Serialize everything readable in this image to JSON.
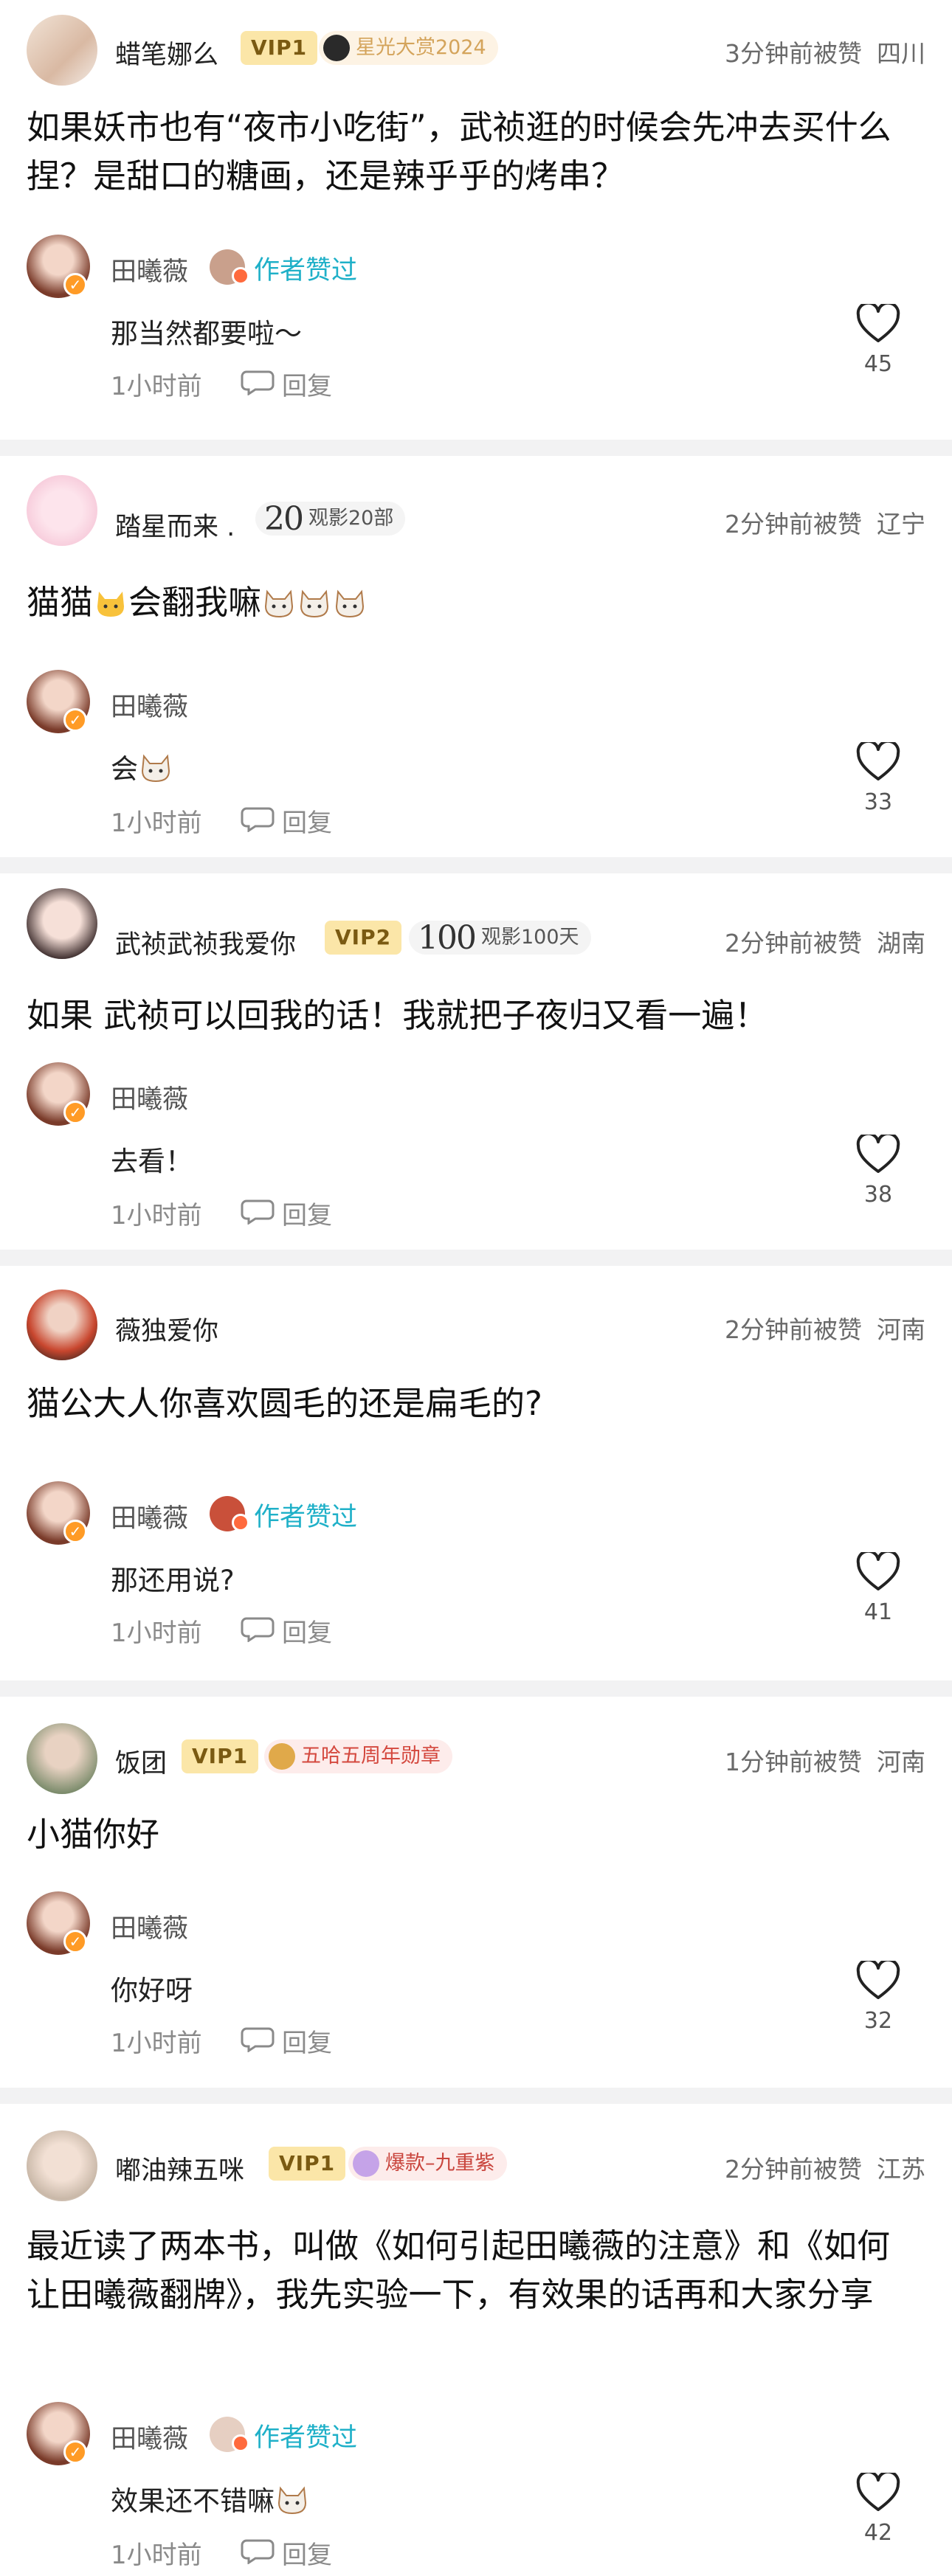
{
  "comments": [
    {
      "user": "蜡笔娜么",
      "vip": "VIP1",
      "badge": "星光大赏2024",
      "time": "3分钟前被赞",
      "region": "四川",
      "text": "如果妖市也有“夜市小吃街”，武祯逛的时候会先冲去买什么捏？是甜口的糖画，还是辣乎乎的烤串？",
      "reply": {
        "user": "田曦薇",
        "liked_label": "作者赞过",
        "text": "那当然都要啦～",
        "time": "1小时前",
        "reply_label": "回复",
        "likes": "45"
      }
    },
    {
      "user": "踏星而来 .",
      "badge_num": "20",
      "badge": "观影20部",
      "time": "2分钟前被赞",
      "region": "辽宁",
      "text": "猫猫",
      "text2": "会翻我嘛",
      "reply": {
        "user": "田曦薇",
        "text": "会",
        "time": "1小时前",
        "reply_label": "回复",
        "likes": "33"
      }
    },
    {
      "user": "武祯武祯我爱你",
      "vip": "VIP2",
      "badge_num": "100",
      "badge": "观影100天",
      "time": "2分钟前被赞",
      "region": "湖南",
      "text": "如果 武祯可以回我的话！我就把子夜归又看一遍！",
      "reply": {
        "user": "田曦薇",
        "text": "去看！",
        "time": "1小时前",
        "reply_label": "回复",
        "likes": "38"
      }
    },
    {
      "user": "薇独爱你",
      "time": "2分钟前被赞",
      "region": "河南",
      "text": "猫公大人你喜欢圆毛的还是扁毛的?",
      "reply": {
        "user": "田曦薇",
        "liked_label": "作者赞过",
        "text": "那还用说?",
        "time": "1小时前",
        "reply_label": "回复",
        "likes": "41"
      }
    },
    {
      "user": "饭团",
      "vip": "VIP1",
      "badge": "五哈五周年勋章",
      "time": "1分钟前被赞",
      "region": "河南",
      "text": "小猫你好",
      "reply": {
        "user": "田曦薇",
        "text": "你好呀",
        "time": "1小时前",
        "reply_label": "回复",
        "likes": "32"
      }
    },
    {
      "user": "嘟油辣五咪",
      "vip": "VIP1",
      "badge": "爆款–九重紫",
      "time": "2分钟前被赞",
      "region": "江苏",
      "text": "最近读了两本书，叫做《如何引起田曦薇的注意》和《如何让田曦薇翻牌》，我先实验一下，有效果的话再和大家分享",
      "reply": {
        "user": "田曦薇",
        "liked_label": "作者赞过",
        "text": "效果还不错嘛",
        "time": "1小时前",
        "reply_label": "回复",
        "likes": "42"
      }
    }
  ],
  "colors": {
    "accent": "#1fb0c8",
    "vip_bg": "#fbe6a8",
    "separator": "#f2f2f3",
    "verified": "#ff9b26"
  },
  "icons": [
    "heart-outline-icon",
    "reply-bubble-icon",
    "verified-badge-icon",
    "cat-emoji-icon"
  ]
}
